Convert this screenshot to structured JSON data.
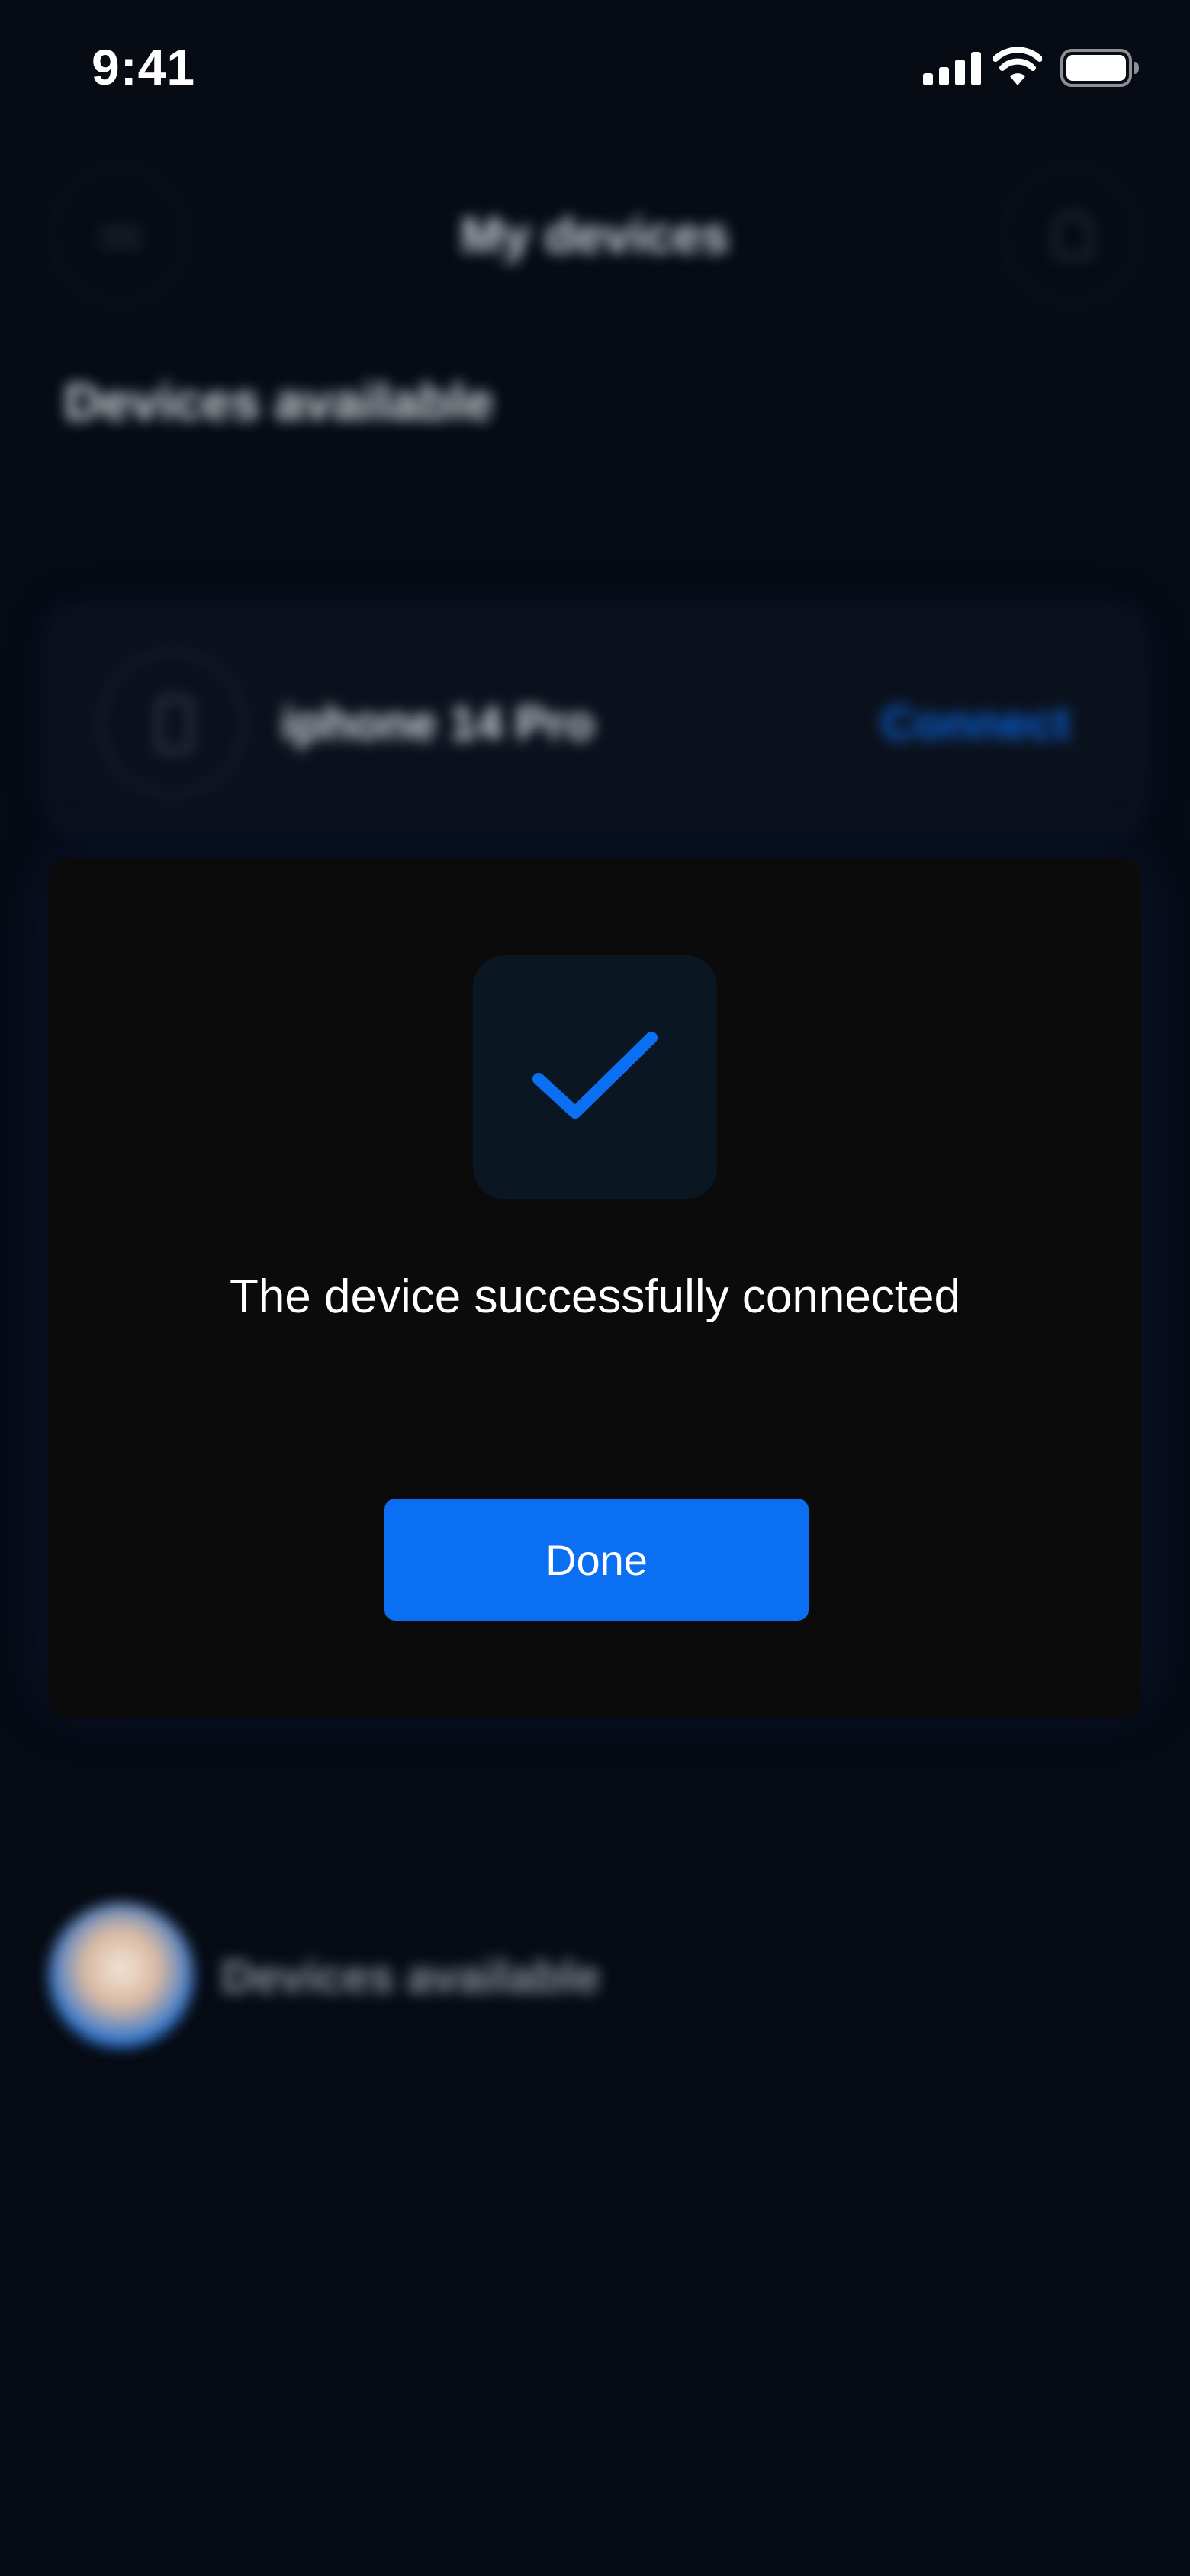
{
  "status_bar": {
    "time": "9:41"
  },
  "background": {
    "header_title": "My devices",
    "section_title": "Devices available",
    "device": {
      "name": "iphone 14 Pro",
      "action_label": "Connect"
    },
    "footer_label": "Devices available"
  },
  "modal": {
    "icon": "checkmark-icon",
    "message": "The device successfully connected",
    "done_label": "Done"
  },
  "colors": {
    "background": "#060b14",
    "modal_background": "#0b0b0b",
    "accent": "#0a6ff2",
    "check_tile": "#0a1622"
  }
}
